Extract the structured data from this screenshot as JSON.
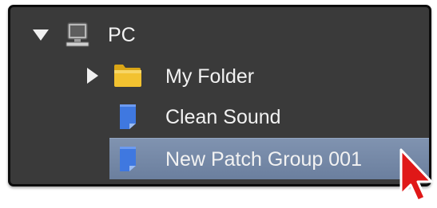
{
  "tree": {
    "root": {
      "label": "PC",
      "icon": "computer-icon",
      "expanded": true,
      "children": [
        {
          "label": "My Folder",
          "icon": "folder-icon",
          "expanded": false
        },
        {
          "label": "Clean Sound",
          "icon": "document-icon",
          "selected": false
        },
        {
          "label": "New Patch Group 001",
          "icon": "document-icon",
          "selected": true
        }
      ]
    }
  },
  "colors": {
    "panel_bg": "#3a3a3a",
    "selection": "#7488a8",
    "text": "#f2f2f2",
    "folder": "#f2c230",
    "document": "#3f78e0",
    "cursor": "#e01818"
  },
  "cursor_icon": "mouse-pointer-icon"
}
